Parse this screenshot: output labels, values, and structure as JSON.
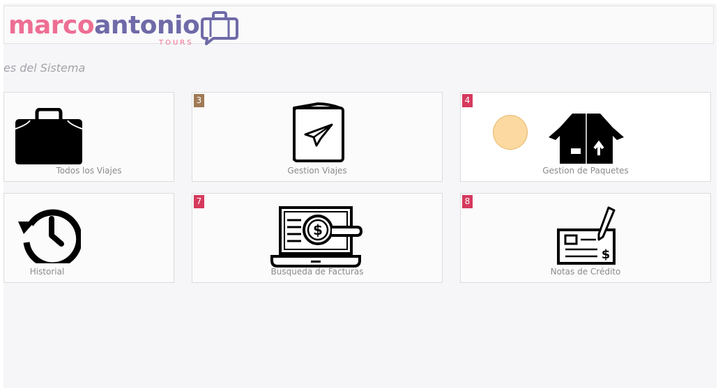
{
  "app": {
    "logo_part1": "marco",
    "logo_part2": "antonio",
    "logo_subtitle": "TOURS"
  },
  "page": {
    "section_title": "es del Sistema"
  },
  "modules": [
    {
      "label": "Todos los Viajes",
      "badge": "",
      "icon": "suitcase-icon"
    },
    {
      "label": "Gestion Viajes",
      "badge": "3",
      "badge_color": "#a07a55",
      "icon": "paper-plane-book-icon"
    },
    {
      "label": "Gestion de Paquetes",
      "badge": "4",
      "badge_color": "#d63a5e",
      "icon": "open-box-icon"
    },
    {
      "label": "Historial",
      "badge": "",
      "icon": "history-clock-icon"
    },
    {
      "label": "Busqueda de Facturas",
      "badge": "7",
      "badge_color": "#d63a5e",
      "icon": "laptop-invoice-search-icon"
    },
    {
      "label": "Notas de Crédito",
      "badge": "8",
      "badge_color": "#d63a5e",
      "icon": "credit-note-check-icon"
    }
  ],
  "colors": {
    "logo_pink": "#ee6e93",
    "logo_purple": "#6f6aa8",
    "badge_red": "#d63a5e",
    "badge_brown": "#a07a55",
    "loader_circle": "#fbd9a0"
  }
}
